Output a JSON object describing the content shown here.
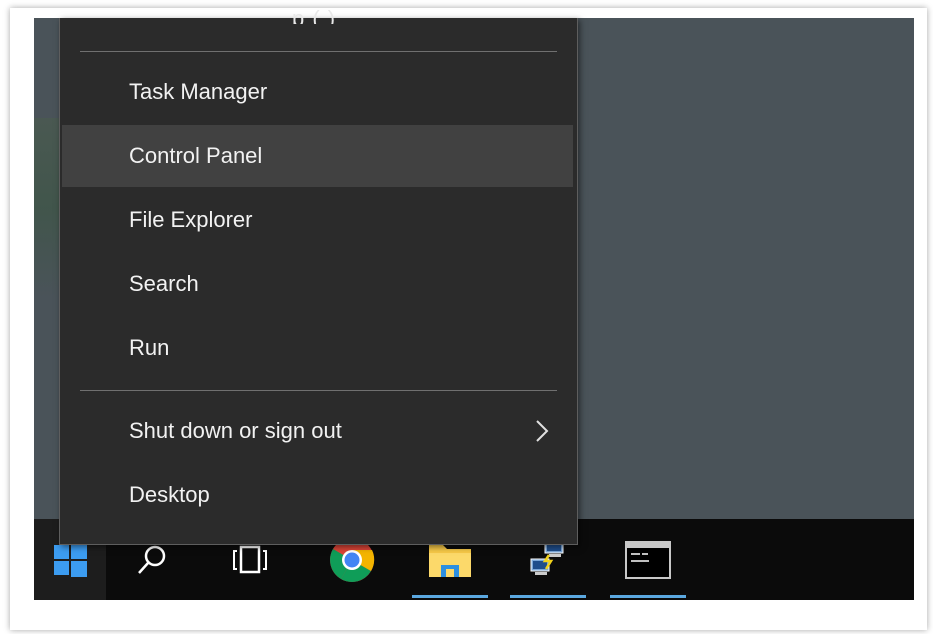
{
  "menu": {
    "top_partial_text": "p (   )",
    "items": [
      {
        "label": "Task Manager"
      },
      {
        "label": "Control Panel"
      },
      {
        "label": "File Explorer"
      },
      {
        "label": "Search"
      },
      {
        "label": "Run"
      },
      {
        "label": "Shut down or sign out"
      },
      {
        "label": "Desktop"
      }
    ],
    "hovered_item": "Control Panel",
    "submenu_arrow_icon": "chevron-right-icon"
  },
  "taskbar": {
    "buttons": [
      {
        "icon": "windows-logo-icon",
        "active": false
      },
      {
        "icon": "search-icon",
        "active": false
      },
      {
        "icon": "task-view-icon",
        "active": false
      },
      {
        "icon": "chrome-icon",
        "active": false
      },
      {
        "icon": "file-explorer-icon",
        "active": true
      },
      {
        "icon": "network-icon",
        "active": true
      },
      {
        "icon": "command-prompt-icon",
        "active": true
      }
    ]
  },
  "colors": {
    "menu_bg": "#2b2b2b",
    "menu_hover": "#414141",
    "desktop_bg": "#4a5359",
    "taskbar_bg": "#0b0b0b",
    "accent": "#5ba8e0",
    "windows_logo": "#3c9cf0"
  }
}
